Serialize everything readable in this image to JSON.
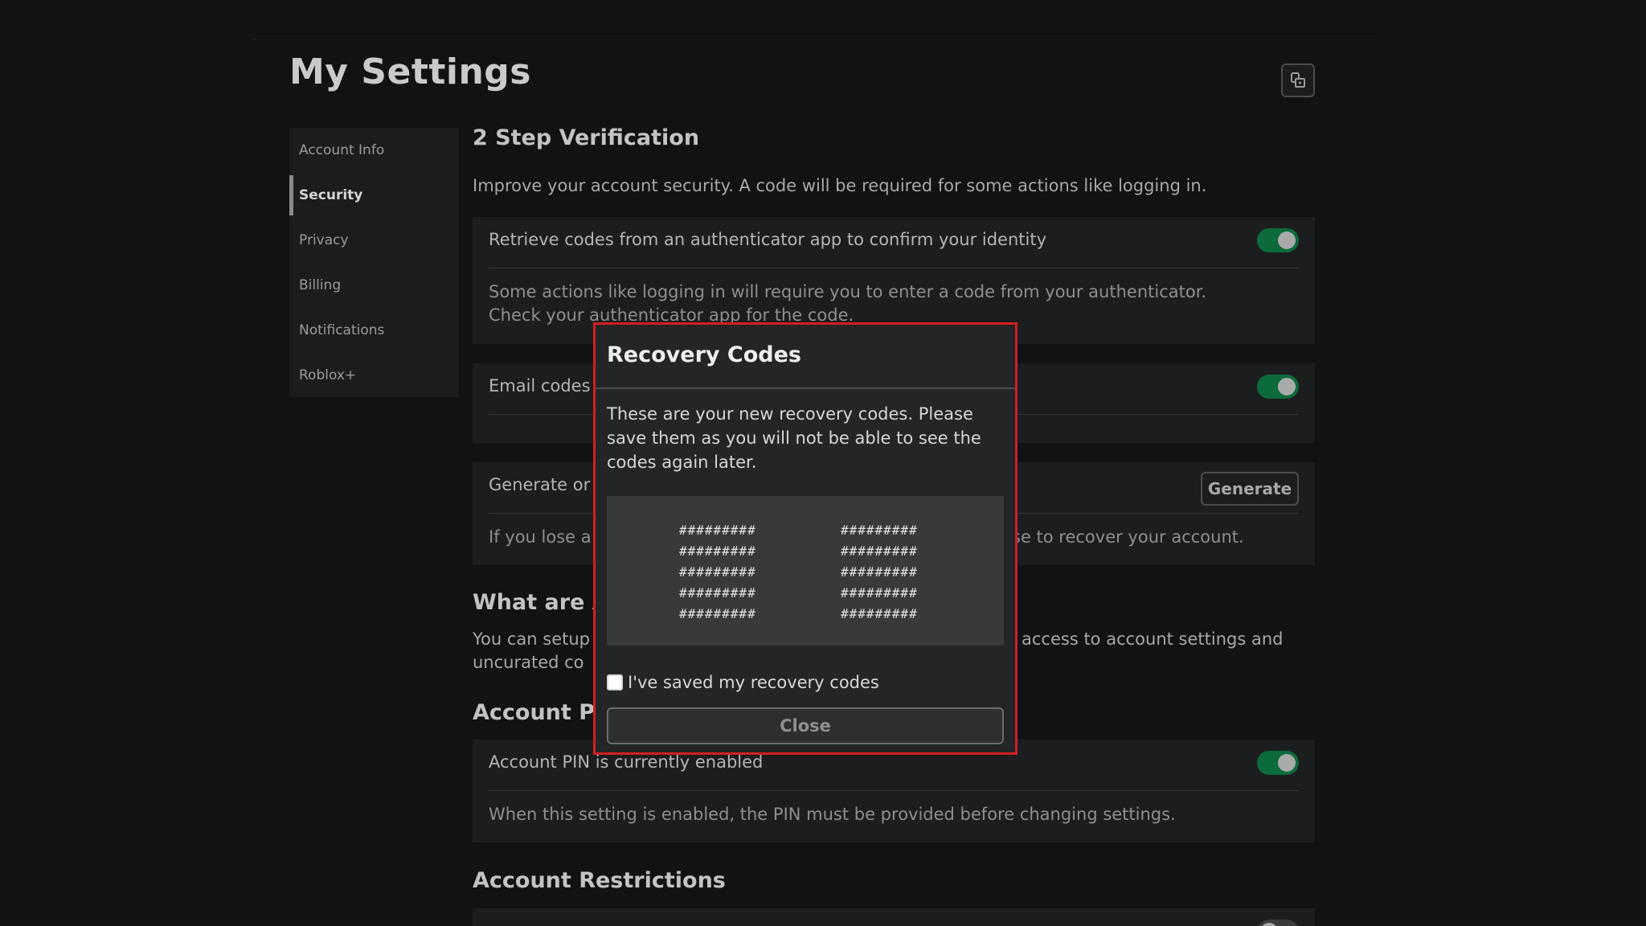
{
  "page": {
    "title": "My Settings",
    "lock_icon": "lock-icon"
  },
  "sidebar": {
    "items": [
      {
        "label": "Account Info",
        "active": false
      },
      {
        "label": "Security",
        "active": true
      },
      {
        "label": "Privacy",
        "active": false
      },
      {
        "label": "Billing",
        "active": false
      },
      {
        "label": "Notifications",
        "active": false
      },
      {
        "label": "Roblox+",
        "active": false
      }
    ]
  },
  "two_step": {
    "heading": "2 Step Verification",
    "description": "Improve your account security. A code will be required for some actions like logging in.",
    "authenticator": {
      "label": "Retrieve codes from an authenticator app to confirm your identity",
      "enabled": true,
      "desc_line1": "Some actions like logging in will require you to enter a code from your authenticator.",
      "desc_line2": "Check your authenticator app for the code."
    },
    "email": {
      "label": "Email codes",
      "enabled": true
    },
    "recovery": {
      "label_partial": "Generate or",
      "button": "Generate",
      "desc_left": "If you lose a",
      "desc_right": "se to recover your account."
    }
  },
  "what_are": {
    "heading_partial": "What are A",
    "text_left_line1": "You can setup",
    "text_left_line2": "uncurated co",
    "text_right": "access to account settings and"
  },
  "account_pin": {
    "heading_partial": "Account PI",
    "label": "Account PIN is currently enabled",
    "enabled": true,
    "desc": "When this setting is enabled, the PIN must be provided before changing settings."
  },
  "account_restrictions": {
    "heading": "Account Restrictions",
    "enabled": false
  },
  "modal": {
    "title": "Recovery Codes",
    "text": "These are your new recovery codes. Please save them as you will not be able to see the codes again later.",
    "codes_left": [
      "#########",
      "#########",
      "#########",
      "#########",
      "#########"
    ],
    "codes_right": [
      "#########",
      "#########",
      "#########",
      "#########",
      "#########"
    ],
    "checkbox_label": "I've saved my recovery codes",
    "checkbox_checked": false,
    "close_button": "Close",
    "border_color": "#d41f1f"
  },
  "colors": {
    "toggle_on": "#0c6b3a",
    "background": "#111213"
  }
}
